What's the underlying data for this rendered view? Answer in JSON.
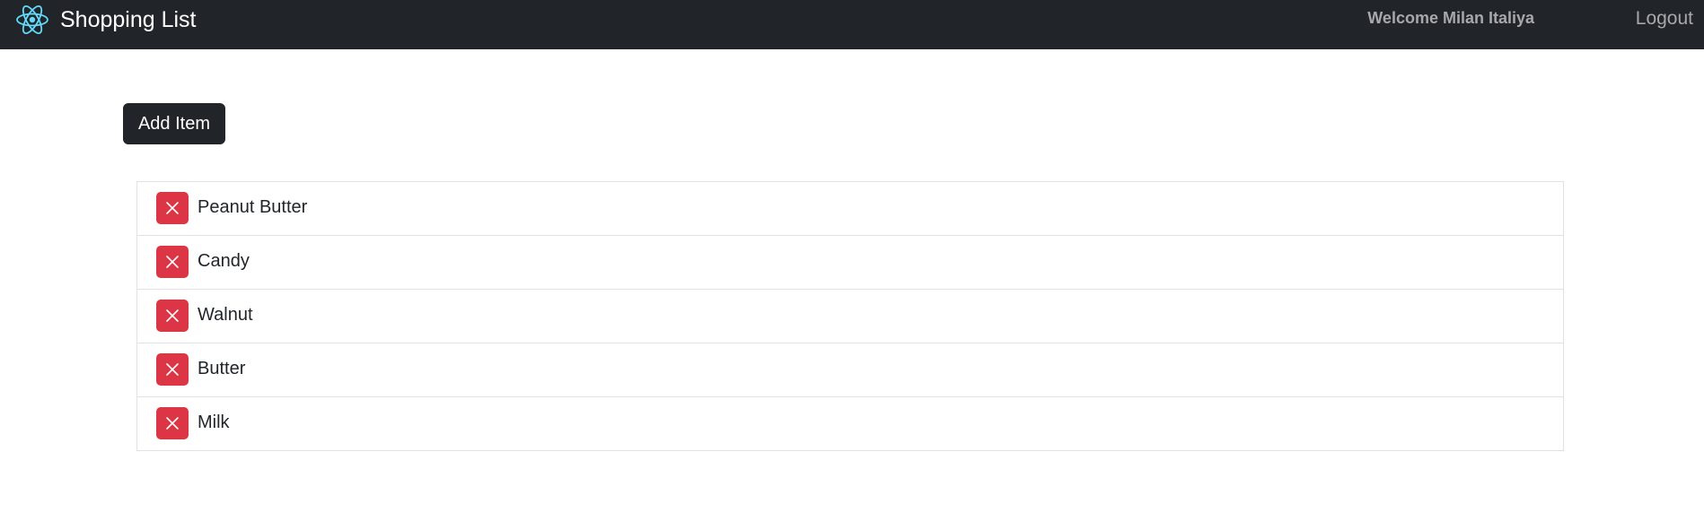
{
  "navbar": {
    "brand_icon": "react-atom-icon",
    "brand_title": "Shopping List",
    "welcome_text": "Welcome Milan Italiya",
    "logout_label": "Logout"
  },
  "main": {
    "add_item_label": "Add Item",
    "items": [
      {
        "label": "Peanut Butter",
        "delete_icon": "close-icon"
      },
      {
        "label": "Candy",
        "delete_icon": "close-icon"
      },
      {
        "label": "Walnut",
        "delete_icon": "close-icon"
      },
      {
        "label": "Butter",
        "delete_icon": "close-icon"
      },
      {
        "label": "Milk",
        "delete_icon": "close-icon"
      }
    ]
  },
  "colors": {
    "navbar_bg": "#212529",
    "delete_button": "#dc3545",
    "brand_icon": "#61dafb"
  }
}
